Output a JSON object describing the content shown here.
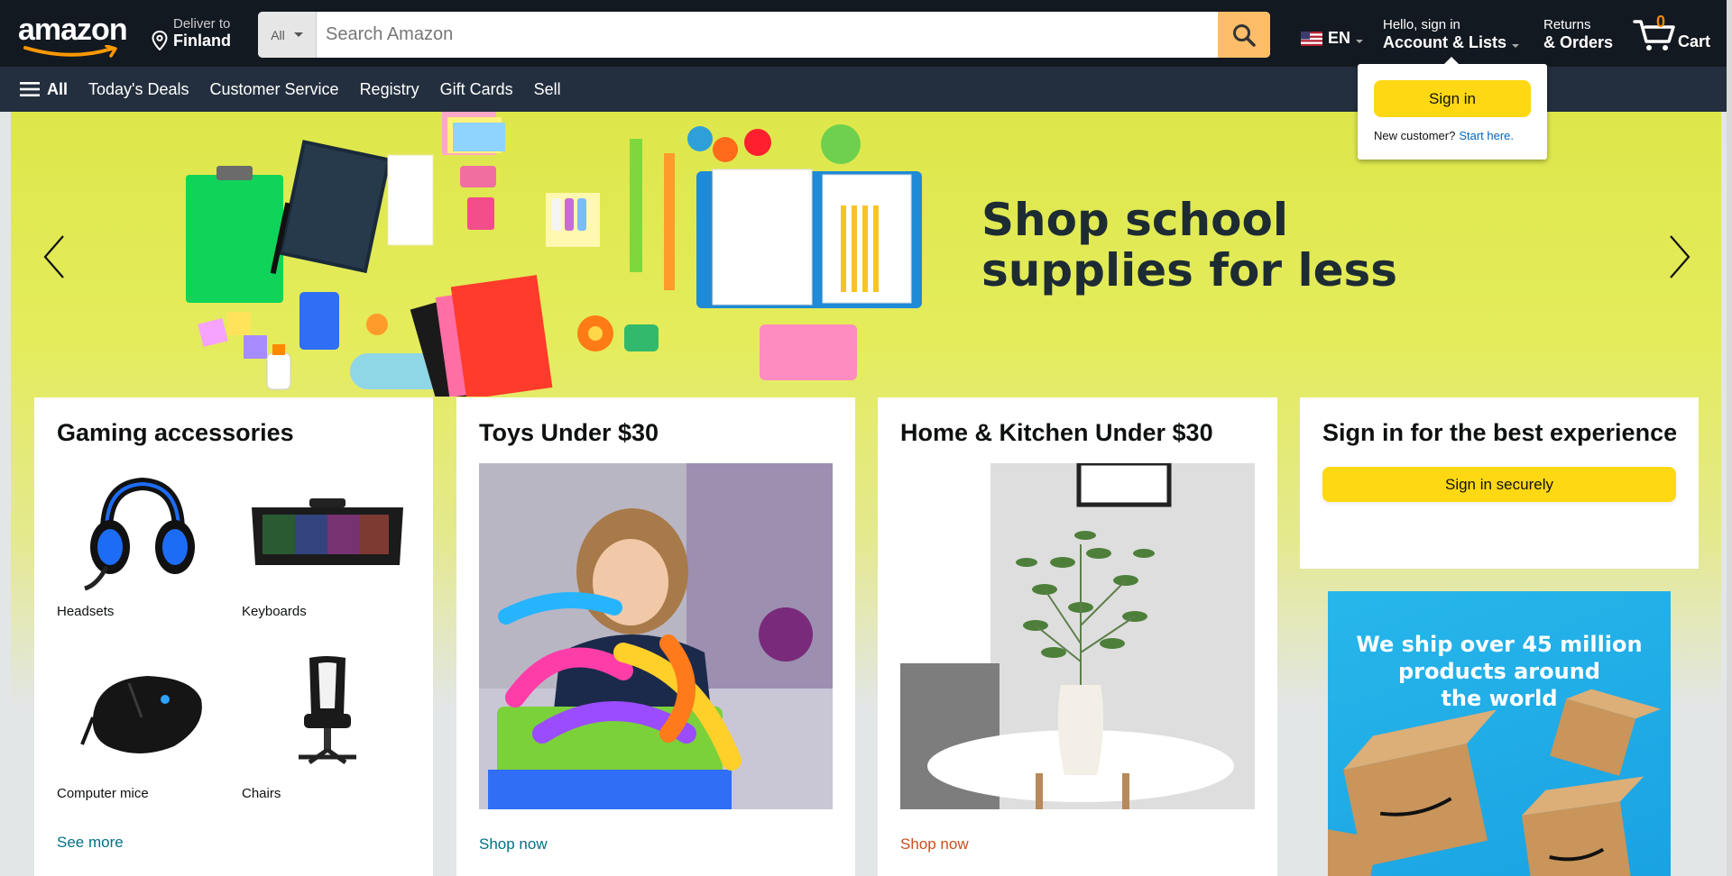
{
  "header": {
    "logo_text": "amazon",
    "deliver_label": "Deliver to",
    "deliver_location": "Finland",
    "search": {
      "category": "All",
      "placeholder": "Search Amazon"
    },
    "language": "EN",
    "account_greeting": "Hello, sign in",
    "account_label": "Account & Lists",
    "returns_label": "Returns",
    "orders_label": "& Orders",
    "cart_count": "0",
    "cart_label": "Cart"
  },
  "nav": {
    "all_label": "All",
    "items": [
      "Today's Deals",
      "Customer Service",
      "Registry",
      "Gift Cards",
      "Sell"
    ]
  },
  "flyout": {
    "signin_button": "Sign in",
    "new_customer": "New customer?",
    "start_here": "Start here."
  },
  "hero": {
    "title": "Shop school\nsupplies for less"
  },
  "cards": {
    "gaming": {
      "title": "Gaming accessories",
      "items": [
        "Headsets",
        "Keyboards",
        "Computer mice",
        "Chairs"
      ],
      "link": "See more"
    },
    "toys": {
      "title": "Toys Under $30",
      "link": "Shop now"
    },
    "home": {
      "title": "Home & Kitchen Under $30",
      "link": "Shop now"
    },
    "signin": {
      "title": "Sign in for the best experience",
      "button": "Sign in securely"
    }
  },
  "ship_ad": {
    "text": "We ship over 45 million\nproducts around\nthe world"
  },
  "colors": {
    "nav_dark": "#131921",
    "nav_secondary": "#232f3e",
    "search_button": "#febd69",
    "primary_button": "#ffd814",
    "link": "#007185",
    "link_accent": "#c7511f",
    "cart_count": "#f08804"
  }
}
